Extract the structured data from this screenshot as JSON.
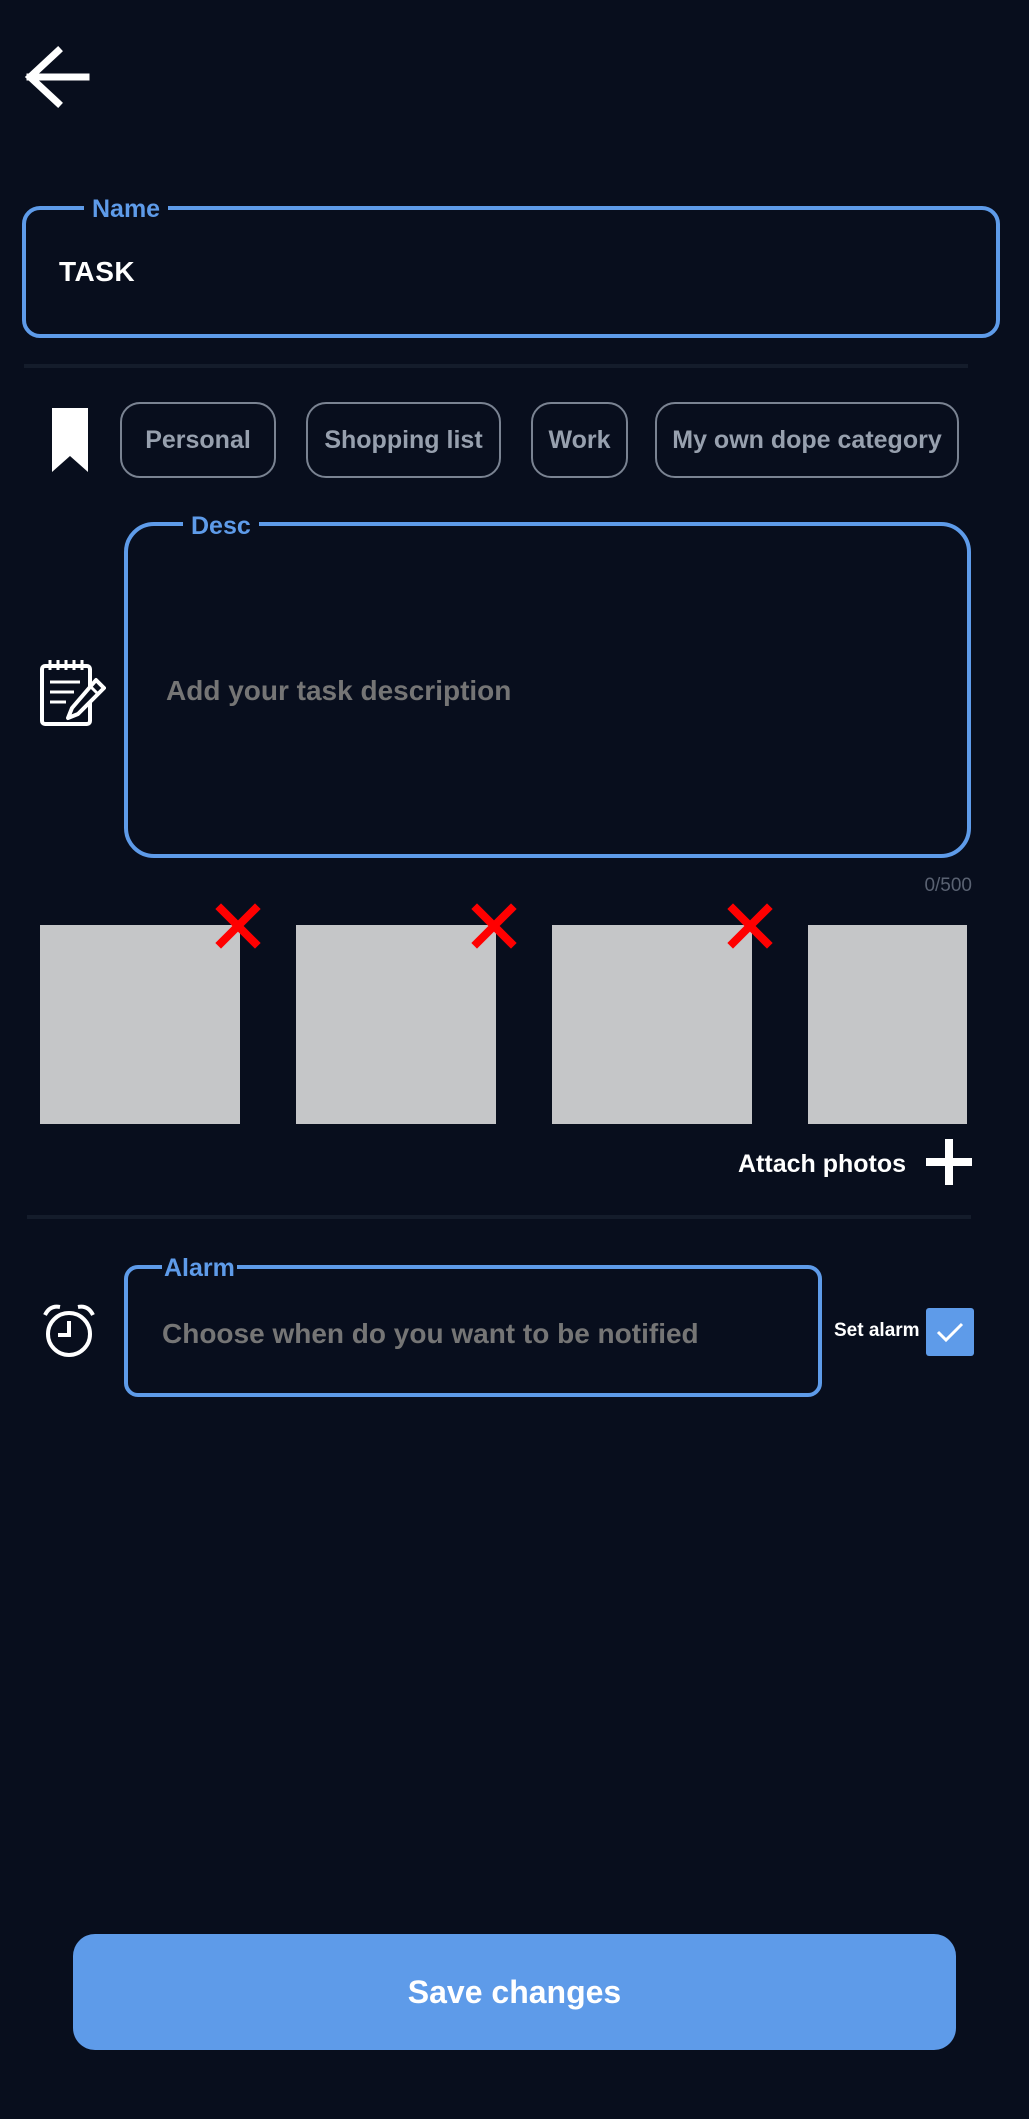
{
  "name_field": {
    "label": "Name",
    "value": "TASK"
  },
  "categories": {
    "icon": "bookmark-icon",
    "items": [
      {
        "label": "Personal"
      },
      {
        "label": "Shopping list"
      },
      {
        "label": "Work"
      },
      {
        "label": "My own dope category"
      }
    ]
  },
  "description": {
    "icon": "notepad-edit-icon",
    "label": "Desc",
    "placeholder": "Add your task description",
    "counter": "0/500"
  },
  "photos": {
    "attach_label": "Attach photos",
    "remove_icon": "close-x-icon",
    "add_icon": "plus-icon"
  },
  "alarm": {
    "icon": "alarm-clock-icon",
    "label": "Alarm",
    "placeholder": "Choose when do you want to be notified",
    "set_alarm_label": "Set alarm",
    "set_alarm_checked": true
  },
  "save_label": "Save changes",
  "colors": {
    "background": "#080e1d",
    "accent": "#5e9be9",
    "placeholder": "#2a4a78",
    "chip_text": "#97a0ae",
    "remove": "#ff0000",
    "photo_placeholder": "#c5c6c8"
  }
}
